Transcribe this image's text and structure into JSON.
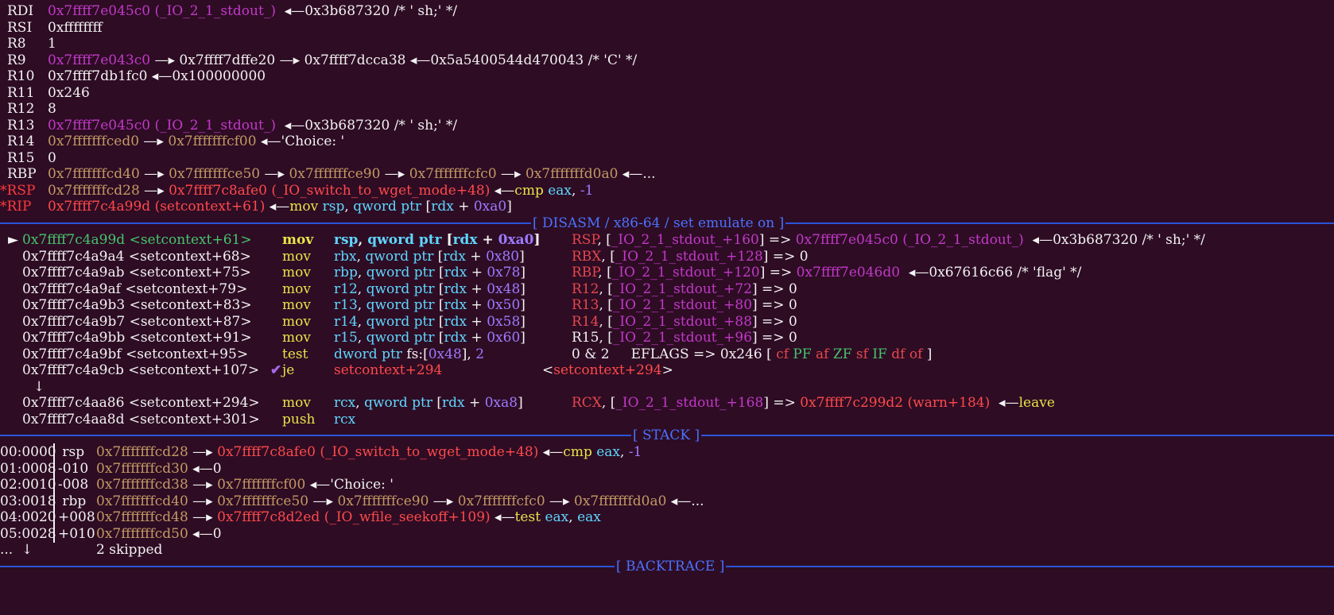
{
  "registers": [
    {
      "name": "RDI",
      "star": false,
      "tokens": [
        [
          "0x7ffff7e045c0",
          "mag"
        ],
        [
          " (_IO_2_1_stdout_)",
          "mag"
        ],
        [
          "  ◂—0x3b687320 /* ' sh;' */",
          "white"
        ]
      ]
    },
    {
      "name": "RSI",
      "star": false,
      "tokens": [
        [
          "0xffffffff",
          "white"
        ]
      ]
    },
    {
      "name": "R8",
      "star": false,
      "tokens": [
        [
          "1",
          "white"
        ]
      ]
    },
    {
      "name": "R9",
      "star": false,
      "tokens": [
        [
          "0x7ffff7e043c0",
          "mag"
        ],
        [
          " —▸ 0x7ffff7dffe20 —▸ 0x7ffff7dcca38 ◂—0x5a5400544d470043 /* 'C' */",
          "white"
        ]
      ]
    },
    {
      "name": "R10",
      "star": false,
      "tokens": [
        [
          "0x7ffff7db1fc0 ◂—0x100000000",
          "white"
        ]
      ]
    },
    {
      "name": "R11",
      "star": false,
      "tokens": [
        [
          "0x246",
          "white"
        ]
      ]
    },
    {
      "name": "R12",
      "star": false,
      "tokens": [
        [
          "8",
          "white"
        ]
      ]
    },
    {
      "name": "R13",
      "star": false,
      "tokens": [
        [
          "0x7ffff7e045c0",
          "mag"
        ],
        [
          " (_IO_2_1_stdout_)",
          "mag"
        ],
        [
          "  ◂—0x3b687320 /* ' sh;' */",
          "white"
        ]
      ]
    },
    {
      "name": "R14",
      "star": false,
      "tokens": [
        [
          "0x7fffffffced0",
          "brown"
        ],
        [
          " —▸ ",
          "white"
        ],
        [
          "0x7fffffffcf00",
          "brown"
        ],
        [
          " ◂—'Choice: '",
          "white"
        ]
      ]
    },
    {
      "name": "R15",
      "star": false,
      "tokens": [
        [
          "0",
          "white"
        ]
      ]
    },
    {
      "name": "RBP",
      "star": false,
      "tokens": [
        [
          "0x7fffffffcd40",
          "brown"
        ],
        [
          " —▸ ",
          "white"
        ],
        [
          "0x7fffffffce50",
          "brown"
        ],
        [
          " —▸ ",
          "white"
        ],
        [
          "0x7fffffffce90",
          "brown"
        ],
        [
          " —▸ ",
          "white"
        ],
        [
          "0x7fffffffcfc0",
          "brown"
        ],
        [
          " —▸ ",
          "white"
        ],
        [
          "0x7fffffffd0a0",
          "brown"
        ],
        [
          " ◂—...",
          "white"
        ]
      ]
    },
    {
      "name": "RSP",
      "star": true,
      "tokens": [
        [
          "0x7fffffffcd28",
          "brown"
        ],
        [
          " —▸ ",
          "white"
        ],
        [
          "0x7ffff7c8afe0 (_IO_switch_to_wget_mode+48)",
          "red"
        ],
        [
          " ◂—",
          "white"
        ],
        [
          "cmp ",
          "yellow"
        ],
        [
          "eax",
          "cyan"
        ],
        [
          ", ",
          "white"
        ],
        [
          "-1",
          "violet"
        ]
      ]
    },
    {
      "name": "RIP",
      "star": true,
      "tokens": [
        [
          "0x7ffff7c4a99d (setcontext+61)",
          "red"
        ],
        [
          " ◂—",
          "white"
        ],
        [
          "mov ",
          "yellow"
        ],
        [
          "rsp",
          "cyan"
        ],
        [
          ", ",
          "white"
        ],
        [
          "qword ptr ",
          "cyan"
        ],
        [
          "[",
          "white"
        ],
        [
          "rdx",
          "cyan"
        ],
        [
          " + ",
          "white"
        ],
        [
          "0xa0",
          "violet"
        ],
        [
          "]",
          "white"
        ]
      ]
    }
  ],
  "disasm_title": "[ DISASM / x86-64 / set emulate on ]",
  "disasm": [
    {
      "arrow": "►",
      "addr": "0x7ffff7c4a99d",
      "sym": "<setcontext+61>",
      "current": true,
      "mnem": "mov",
      "ops": [
        [
          "rsp",
          "cyan"
        ],
        [
          ", ",
          "white"
        ],
        [
          "qword ptr ",
          "cyan"
        ],
        [
          "[",
          "white"
        ],
        [
          "rdx",
          "cyan"
        ],
        [
          " + ",
          "white"
        ],
        [
          "0xa0",
          "violet"
        ],
        [
          "]",
          "white"
        ]
      ],
      "comment": [
        [
          "RSP",
          "dred"
        ],
        [
          ", [",
          "white"
        ],
        [
          "_IO_2_1_stdout_+160",
          "mag"
        ],
        [
          "] => ",
          "white"
        ],
        [
          "0x7ffff7e045c0 (_IO_2_1_stdout_)",
          "mag"
        ],
        [
          "  ◂—0x3b687320 /* ' sh;' */",
          "white"
        ]
      ]
    },
    {
      "arrow": "",
      "addr": "0x7ffff7c4a9a4",
      "sym": "<setcontext+68>",
      "current": false,
      "mnem": "mov",
      "ops": [
        [
          "rbx",
          "cyan"
        ],
        [
          ", ",
          "white"
        ],
        [
          "qword ptr ",
          "cyan"
        ],
        [
          "[",
          "white"
        ],
        [
          "rdx",
          "cyan"
        ],
        [
          " + ",
          "white"
        ],
        [
          "0x80",
          "violet"
        ],
        [
          "]",
          "white"
        ]
      ],
      "comment": [
        [
          "RBX",
          "dred"
        ],
        [
          ", [",
          "white"
        ],
        [
          "_IO_2_1_stdout_+128",
          "mag"
        ],
        [
          "] => 0",
          "white"
        ]
      ]
    },
    {
      "arrow": "",
      "addr": "0x7ffff7c4a9ab",
      "sym": "<setcontext+75>",
      "current": false,
      "mnem": "mov",
      "ops": [
        [
          "rbp",
          "cyan"
        ],
        [
          ", ",
          "white"
        ],
        [
          "qword ptr ",
          "cyan"
        ],
        [
          "[",
          "white"
        ],
        [
          "rdx",
          "cyan"
        ],
        [
          " + ",
          "white"
        ],
        [
          "0x78",
          "violet"
        ],
        [
          "]",
          "white"
        ]
      ],
      "comment": [
        [
          "RBP",
          "dred"
        ],
        [
          ", [",
          "white"
        ],
        [
          "_IO_2_1_stdout_+120",
          "mag"
        ],
        [
          "] => ",
          "white"
        ],
        [
          "0x7ffff7e046d0",
          "mag"
        ],
        [
          "  ◂—0x67616c66 /* 'flag' */",
          "white"
        ]
      ]
    },
    {
      "arrow": "",
      "addr": "0x7ffff7c4a9af",
      "sym": "<setcontext+79>",
      "current": false,
      "mnem": "mov",
      "ops": [
        [
          "r12",
          "cyan"
        ],
        [
          ", ",
          "white"
        ],
        [
          "qword ptr ",
          "cyan"
        ],
        [
          "[",
          "white"
        ],
        [
          "rdx",
          "cyan"
        ],
        [
          " + ",
          "white"
        ],
        [
          "0x48",
          "violet"
        ],
        [
          "]",
          "white"
        ]
      ],
      "comment": [
        [
          "R12",
          "dred"
        ],
        [
          ", [",
          "white"
        ],
        [
          "_IO_2_1_stdout_+72",
          "mag"
        ],
        [
          "] => 0",
          "white"
        ]
      ]
    },
    {
      "arrow": "",
      "addr": "0x7ffff7c4a9b3",
      "sym": "<setcontext+83>",
      "current": false,
      "mnem": "mov",
      "ops": [
        [
          "r13",
          "cyan"
        ],
        [
          ", ",
          "white"
        ],
        [
          "qword ptr ",
          "cyan"
        ],
        [
          "[",
          "white"
        ],
        [
          "rdx",
          "cyan"
        ],
        [
          " + ",
          "white"
        ],
        [
          "0x50",
          "violet"
        ],
        [
          "]",
          "white"
        ]
      ],
      "comment": [
        [
          "R13",
          "dred"
        ],
        [
          ", [",
          "white"
        ],
        [
          "_IO_2_1_stdout_+80",
          "mag"
        ],
        [
          "] => 0",
          "white"
        ]
      ]
    },
    {
      "arrow": "",
      "addr": "0x7ffff7c4a9b7",
      "sym": "<setcontext+87>",
      "current": false,
      "mnem": "mov",
      "ops": [
        [
          "r14",
          "cyan"
        ],
        [
          ", ",
          "white"
        ],
        [
          "qword ptr ",
          "cyan"
        ],
        [
          "[",
          "white"
        ],
        [
          "rdx",
          "cyan"
        ],
        [
          " + ",
          "white"
        ],
        [
          "0x58",
          "violet"
        ],
        [
          "]",
          "white"
        ]
      ],
      "comment": [
        [
          "R14",
          "dred"
        ],
        [
          ", [",
          "white"
        ],
        [
          "_IO_2_1_stdout_+88",
          "mag"
        ],
        [
          "] => 0",
          "white"
        ]
      ]
    },
    {
      "arrow": "",
      "addr": "0x7ffff7c4a9bb",
      "sym": "<setcontext+91>",
      "current": false,
      "mnem": "mov",
      "ops": [
        [
          "r15",
          "cyan"
        ],
        [
          ", ",
          "white"
        ],
        [
          "qword ptr ",
          "cyan"
        ],
        [
          "[",
          "white"
        ],
        [
          "rdx",
          "cyan"
        ],
        [
          " + ",
          "white"
        ],
        [
          "0x60",
          "violet"
        ],
        [
          "]",
          "white"
        ]
      ],
      "comment": [
        [
          "R15",
          "white"
        ],
        [
          ", [",
          "white"
        ],
        [
          "_IO_2_1_stdout_+96",
          "mag"
        ],
        [
          "] => 0",
          "white"
        ]
      ]
    },
    {
      "arrow": "",
      "addr": "0x7ffff7c4a9bf",
      "sym": "<setcontext+95>",
      "current": false,
      "mnem": "test",
      "ops": [
        [
          "dword ptr ",
          "cyan"
        ],
        [
          "fs:",
          "white"
        ],
        [
          "[",
          "white"
        ],
        [
          "0x48",
          "violet"
        ],
        [
          "], ",
          "white"
        ],
        [
          "2",
          "violet"
        ]
      ],
      "comment": [
        [
          "0 & 2     EFLAGS => 0x246 [ ",
          "white"
        ],
        [
          "cf ",
          "dred"
        ],
        [
          "PF ",
          "green"
        ],
        [
          "af ",
          "dred"
        ],
        [
          "ZF ",
          "green"
        ],
        [
          "sf ",
          "dred"
        ],
        [
          "IF ",
          "green"
        ],
        [
          "df ",
          "dred"
        ],
        [
          "of ",
          "dred"
        ],
        [
          "]",
          "white"
        ]
      ]
    },
    {
      "arrow": "",
      "addr": "0x7ffff7c4a9cb",
      "sym": "<setcontext+107>",
      "current": false,
      "check": "✔",
      "mnem": "je",
      "ops": [
        [
          "setcontext+294",
          "red"
        ]
      ],
      "comment": [
        [
          "<",
          "white"
        ],
        [
          "setcontext+294",
          "red"
        ],
        [
          ">",
          "white"
        ]
      ]
    },
    {
      "arrow": "↓",
      "addr": "",
      "sym": "",
      "current": false,
      "mnem": "",
      "ops": [],
      "comment": []
    },
    {
      "arrow": "",
      "addr": "0x7ffff7c4aa86",
      "sym": "<setcontext+294>",
      "current": false,
      "mnem": "mov",
      "ops": [
        [
          "rcx",
          "cyan"
        ],
        [
          ", ",
          "white"
        ],
        [
          "qword ptr ",
          "cyan"
        ],
        [
          "[",
          "white"
        ],
        [
          "rdx",
          "cyan"
        ],
        [
          " + ",
          "white"
        ],
        [
          "0xa8",
          "violet"
        ],
        [
          "]",
          "white"
        ]
      ],
      "comment": [
        [
          "RCX",
          "dred"
        ],
        [
          ", [",
          "white"
        ],
        [
          "_IO_2_1_stdout_+168",
          "mag"
        ],
        [
          "] => ",
          "white"
        ],
        [
          "0x7ffff7c299d2 (warn+184)",
          "red"
        ],
        [
          "  ◂—",
          "white"
        ],
        [
          "leave",
          "yellow"
        ]
      ]
    },
    {
      "arrow": "",
      "addr": "0x7ffff7c4aa8d",
      "sym": "<setcontext+301>",
      "current": false,
      "mnem": "push",
      "ops": [
        [
          "rcx",
          "cyan"
        ]
      ],
      "comment": []
    }
  ],
  "stack_title": "[ STACK ]",
  "stack": [
    {
      "idx": "00:0000",
      "off": " rsp",
      "tokens": [
        [
          "0x7fffffffcd28",
          "brown"
        ],
        [
          " —▸ ",
          "white"
        ],
        [
          "0x7ffff7c8afe0 (_IO_switch_to_wget_mode+48)",
          "red"
        ],
        [
          " ◂—",
          "white"
        ],
        [
          "cmp ",
          "yellow"
        ],
        [
          "eax",
          "cyan"
        ],
        [
          ", ",
          "white"
        ],
        [
          "-1",
          "violet"
        ]
      ]
    },
    {
      "idx": "01:0008",
      "off": "-010",
      "tokens": [
        [
          "0x7fffffffcd30",
          "brown"
        ],
        [
          " ◂—0",
          "white"
        ]
      ]
    },
    {
      "idx": "02:0010",
      "off": "-008",
      "tokens": [
        [
          "0x7fffffffcd38",
          "brown"
        ],
        [
          " —▸ ",
          "white"
        ],
        [
          "0x7fffffffcf00",
          "brown"
        ],
        [
          " ◂—'Choice: '",
          "white"
        ]
      ]
    },
    {
      "idx": "03:0018",
      "off": " rbp",
      "tokens": [
        [
          "0x7fffffffcd40",
          "brown"
        ],
        [
          " —▸ ",
          "white"
        ],
        [
          "0x7fffffffce50",
          "brown"
        ],
        [
          " —▸ ",
          "white"
        ],
        [
          "0x7fffffffce90",
          "brown"
        ],
        [
          " —▸ ",
          "white"
        ],
        [
          "0x7fffffffcfc0",
          "brown"
        ],
        [
          " —▸ ",
          "white"
        ],
        [
          "0x7fffffffd0a0",
          "brown"
        ],
        [
          " ◂—...",
          "white"
        ]
      ]
    },
    {
      "idx": "04:0020",
      "off": "+008",
      "tokens": [
        [
          "0x7fffffffcd48",
          "brown"
        ],
        [
          " —▸ ",
          "white"
        ],
        [
          "0x7ffff7c8d2ed (_IO_wfile_seekoff+109)",
          "red"
        ],
        [
          " ◂—",
          "white"
        ],
        [
          "test ",
          "yellow"
        ],
        [
          "eax",
          "cyan"
        ],
        [
          ", ",
          "white"
        ],
        [
          "eax",
          "cyan"
        ]
      ]
    },
    {
      "idx": "05:0028",
      "off": "+010",
      "tokens": [
        [
          "0x7fffffffcd50",
          "brown"
        ],
        [
          " ◂—0",
          "white"
        ]
      ]
    }
  ],
  "skipped": "2 skipped",
  "skipped_prefix": "...  ↓",
  "backtrace_title": "[ BACKTRACE ]"
}
